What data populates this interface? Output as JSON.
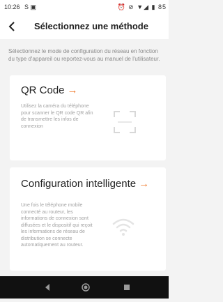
{
  "status_bar": {
    "time": "10:26",
    "notification_icons": "S ▣",
    "right_icons": "⏰ ⊘ ▼◢ ▮ 85"
  },
  "header": {
    "title": "Sélectionnez une méthode"
  },
  "intro_text": "Sélectionnez le mode de configuration du réseau en fonction du type d'appareil ou reportez-vous au manuel de l'utilisateur.",
  "cards": [
    {
      "title": "QR Code",
      "arrow": "→",
      "description": "Utilisez la caméra du téléphone pour scanner le QR code QR afin de transmettre les infos de connexion",
      "icon": "qr-scan-icon"
    },
    {
      "title": "Configuration intelligente",
      "arrow": "→",
      "description": "Une fois le téléphone mobile connecté au routeur, les informations de connexion sont diffusées et le dispositif qui reçoit les informations de réseau de distribution se connecte automatiquement au routeur.",
      "icon": "wifi-icon"
    }
  ],
  "colors": {
    "accent": "#f07a2c",
    "background": "#f3f3f3",
    "card": "#ffffff",
    "nav_bar": "#111111"
  }
}
